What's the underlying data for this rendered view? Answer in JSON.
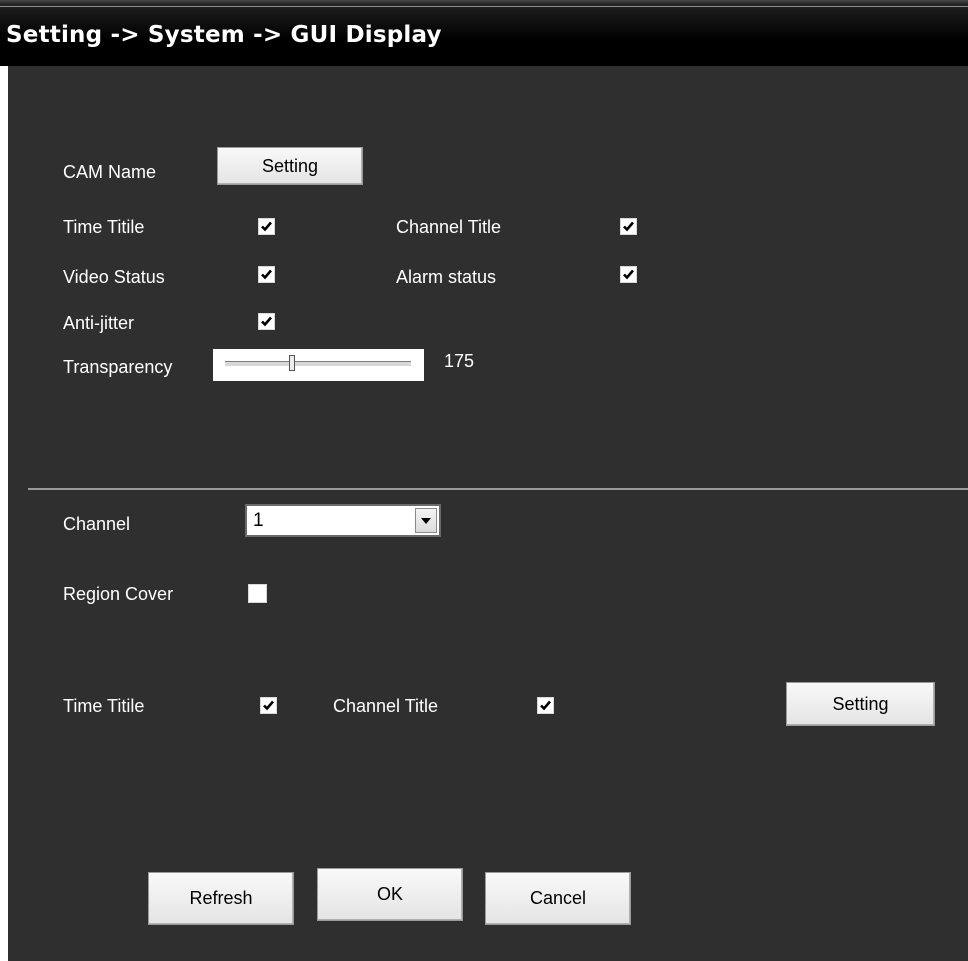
{
  "header": {
    "title": "Setting -> System -> GUI Display"
  },
  "display": {
    "cam_name_label": "CAM Name",
    "cam_name_button": "Setting",
    "time_title_label": "Time Titile",
    "time_title_checked": true,
    "channel_title_label": "Channel Title",
    "channel_title_checked": true,
    "video_status_label": "Video Status",
    "video_status_checked": true,
    "alarm_status_label": "Alarm status",
    "alarm_status_checked": true,
    "anti_jitter_label": "Anti-jitter",
    "anti_jitter_checked": true,
    "transparency_label": "Transparency",
    "transparency_value": "175"
  },
  "channel_section": {
    "channel_label": "Channel",
    "channel_value": "1",
    "region_cover_label": "Region Cover",
    "region_cover_checked": false,
    "time_title_label": "Time Titile",
    "time_title_checked": true,
    "channel_title_label": "Channel Title",
    "channel_title_checked": true,
    "setting_button": "Setting"
  },
  "footer": {
    "refresh_button": "Refresh",
    "ok_button": "OK",
    "cancel_button": "Cancel"
  },
  "icons": {
    "checkbox_check": "check-icon",
    "dropdown": "chevron-down-icon"
  }
}
